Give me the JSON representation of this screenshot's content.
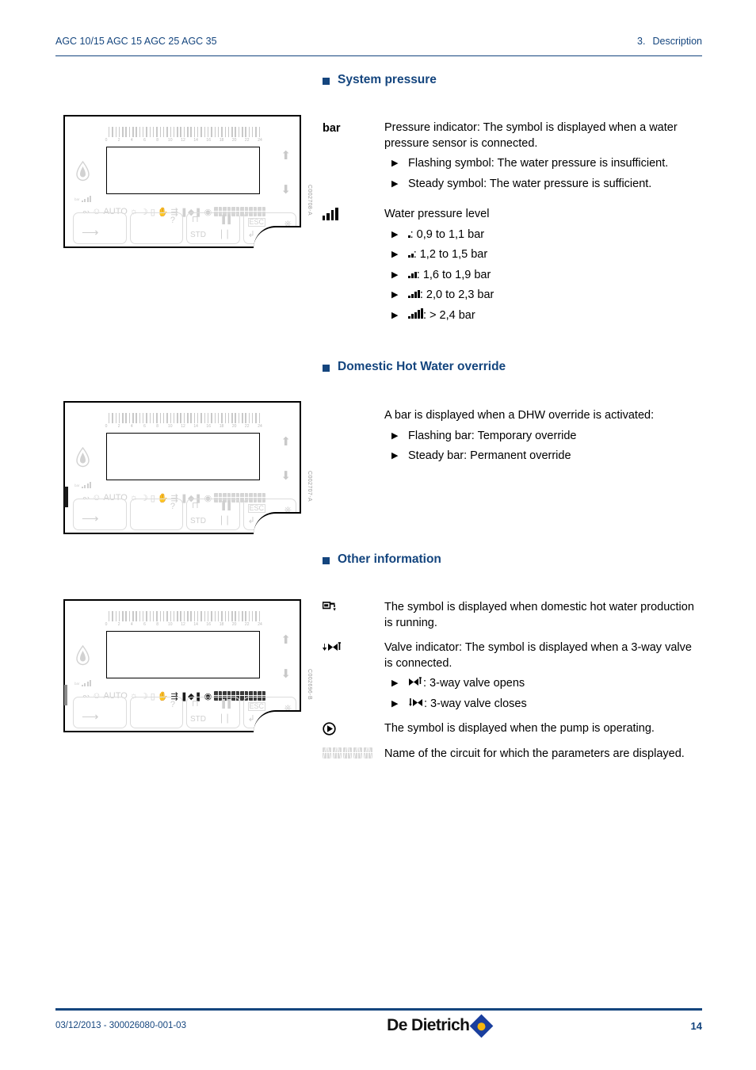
{
  "header": {
    "left": "AGC 10/15 AGC 15 AGC 25 AGC 35",
    "chapter_number": "3.",
    "chapter_title": "Description"
  },
  "sections": [
    {
      "id": "system-pressure",
      "title": "System pressure",
      "entries": [
        {
          "symbol": "bar-text",
          "symbol_label": "bar",
          "text": "Pressure indicator: The symbol is displayed when a water pressure sensor is connected.",
          "bullets": [
            {
              "icon": "",
              "text": "Flashing symbol: The water pressure is insufficient."
            },
            {
              "icon": "",
              "text": "Steady symbol: The water pressure is sufficient."
            }
          ]
        },
        {
          "symbol": "signal-bars-icon",
          "symbol_label": "",
          "text": "Water pressure level",
          "bullets": [
            {
              "icon": "bars-1",
              "text": ": 0,9 to 1,1 bar"
            },
            {
              "icon": "bars-2",
              "text": ": 1,2 to 1,5 bar"
            },
            {
              "icon": "bars-3",
              "text": ": 1,6 to 1,9 bar"
            },
            {
              "icon": "bars-4",
              "text": ": 2,0 to 2,3 bar"
            },
            {
              "icon": "bars-5",
              "text": ": > 2,4 bar"
            }
          ]
        }
      ]
    },
    {
      "id": "dhw-override",
      "title": "Domestic Hot Water override",
      "entries": [
        {
          "symbol": "none",
          "symbol_label": "",
          "text": "A bar is displayed when a DHW override is activated:",
          "bullets": [
            {
              "icon": "",
              "text": "Flashing bar: Temporary override"
            },
            {
              "icon": "",
              "text": "Steady bar: Permanent override"
            }
          ]
        }
      ]
    },
    {
      "id": "other-information",
      "title": "Other information",
      "entries": [
        {
          "symbol": "tap-icon",
          "symbol_label": "",
          "text": "The symbol is displayed when domestic hot water production is running.",
          "bullets": []
        },
        {
          "symbol": "three-way-valve-icon",
          "symbol_label": "",
          "text": "Valve indicator: The symbol is displayed when a 3-way valve is connected.",
          "bullets": [
            {
              "icon": "valve-open",
              "text": ": 3-way valve opens"
            },
            {
              "icon": "valve-close",
              "text": ": 3-way valve closes"
            }
          ]
        },
        {
          "symbol": "pump-icon",
          "symbol_label": "",
          "text": "The symbol is displayed when the pump is operating.",
          "bullets": []
        },
        {
          "symbol": "lcd-characters-icon",
          "symbol_label": "",
          "text": "Name of the circuit for which the parameters are displayed.",
          "bullets": []
        }
      ]
    }
  ],
  "panels": [
    {
      "id": "panel-pressure",
      "ref": "C002708-A",
      "highlight": "none"
    },
    {
      "id": "panel-dhw-override",
      "ref": "C002707-A",
      "highlight": "dhw-bar"
    },
    {
      "id": "panel-other-info",
      "ref": "C002696-B",
      "highlight": "symbol-group"
    }
  ],
  "panel_ui": {
    "auto_label": "AUTO",
    "std_label": "STD",
    "esc_label": "ESC",
    "help_label": "?",
    "bar_label": "bar",
    "scale_ticks": [
      "0",
      "2",
      "4",
      "6",
      "8",
      "10",
      "12",
      "14",
      "16",
      "18",
      "20",
      "22",
      "24"
    ]
  },
  "footer": {
    "left": "03/12/2013 - 300026080-001-03",
    "brand": "De Dietrich",
    "page": "14"
  },
  "colors": {
    "accent": "#14457e",
    "logo_blue": "#1a3f9e",
    "logo_gold": "#f5b60d",
    "panel_gray": "#cfcfcf"
  }
}
